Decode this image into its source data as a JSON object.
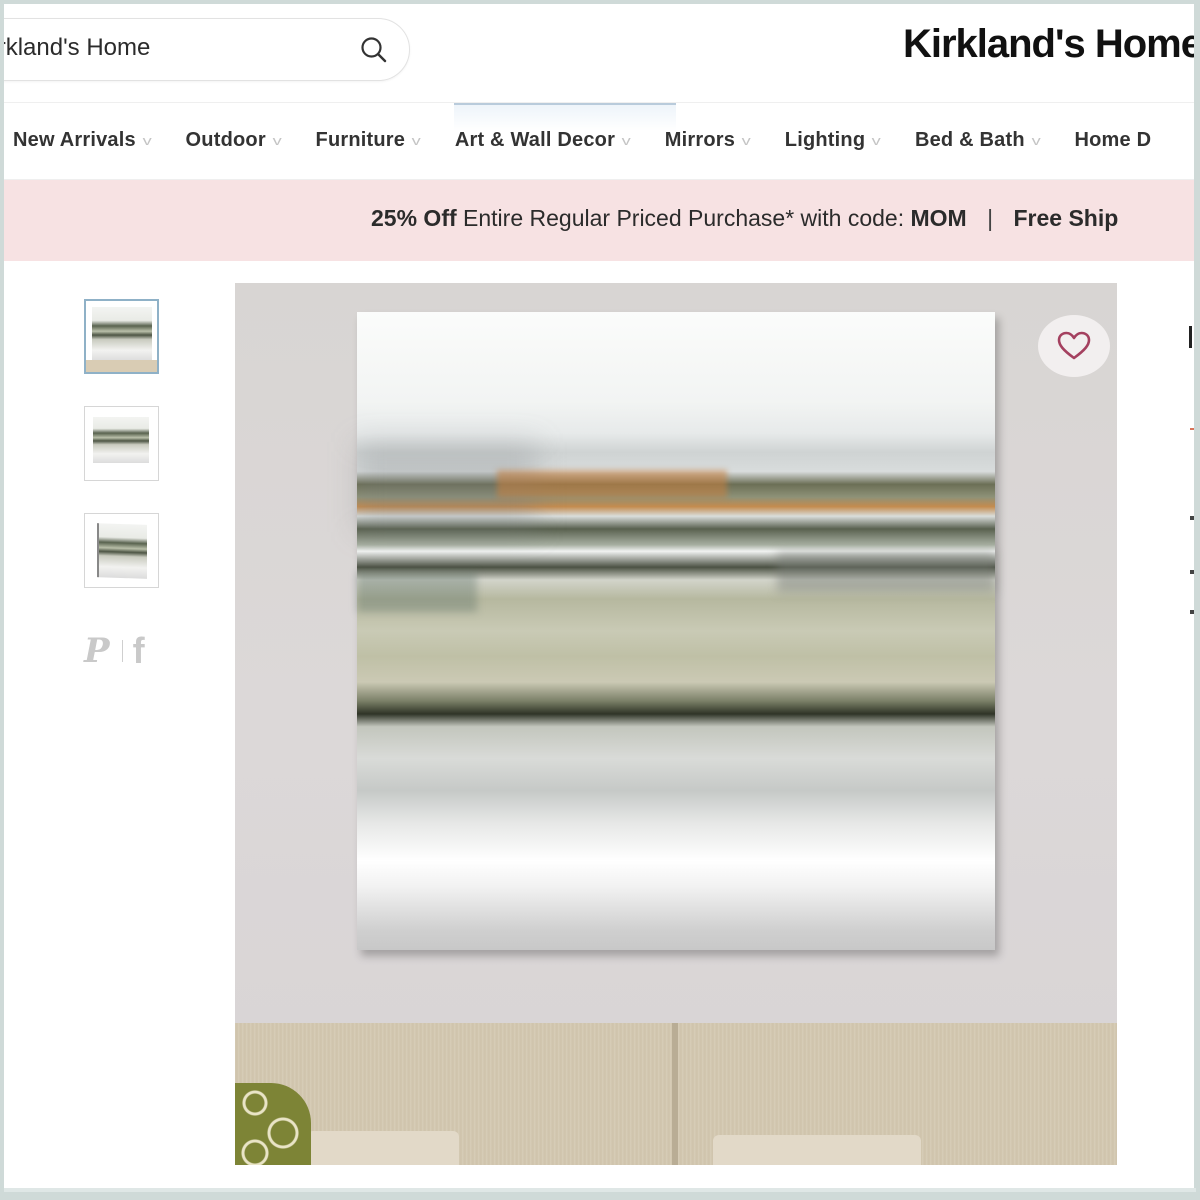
{
  "header": {
    "search_value": "arch Kirkland's Home",
    "search_placeholder": "Search Kirkland's Home",
    "search_icon": "search-icon",
    "logo_text": "Kirkland's Home"
  },
  "nav": {
    "active_index": 3,
    "items": [
      {
        "label": "New Arrivals",
        "icon": "chevron-down-icon"
      },
      {
        "label": "Outdoor",
        "icon": "chevron-down-icon"
      },
      {
        "label": "Furniture",
        "icon": "chevron-down-icon"
      },
      {
        "label": "Art & Wall Decor",
        "icon": "chevron-down-icon"
      },
      {
        "label": "Mirrors",
        "icon": "chevron-down-icon"
      },
      {
        "label": "Lighting",
        "icon": "chevron-down-icon"
      },
      {
        "label": "Bed & Bath",
        "icon": "chevron-down-icon"
      },
      {
        "label": "Home D"
      }
    ]
  },
  "promo": {
    "discount": "25% Off",
    "text": "Entire Regular Priced Purchase* with code:",
    "code": "MOM",
    "separator": "|",
    "shipping": "Free Ship",
    "background": "#f7e2e3"
  },
  "gallery": {
    "thumbnails": [
      {
        "label": "Room view thumbnail",
        "selected": true
      },
      {
        "label": "Front view thumbnail",
        "selected": false
      },
      {
        "label": "Angle view thumbnail",
        "selected": false
      }
    ],
    "share": {
      "pinterest": "pinterest-icon",
      "facebook": "facebook-icon",
      "pinterest_glyph": "P",
      "facebook_glyph": "f"
    },
    "main_image_alt": "Abstract watercolor landscape canvas art above a beige sofa",
    "wishlist_icon": "heart-icon",
    "wishlist_color": "#a4405f"
  }
}
